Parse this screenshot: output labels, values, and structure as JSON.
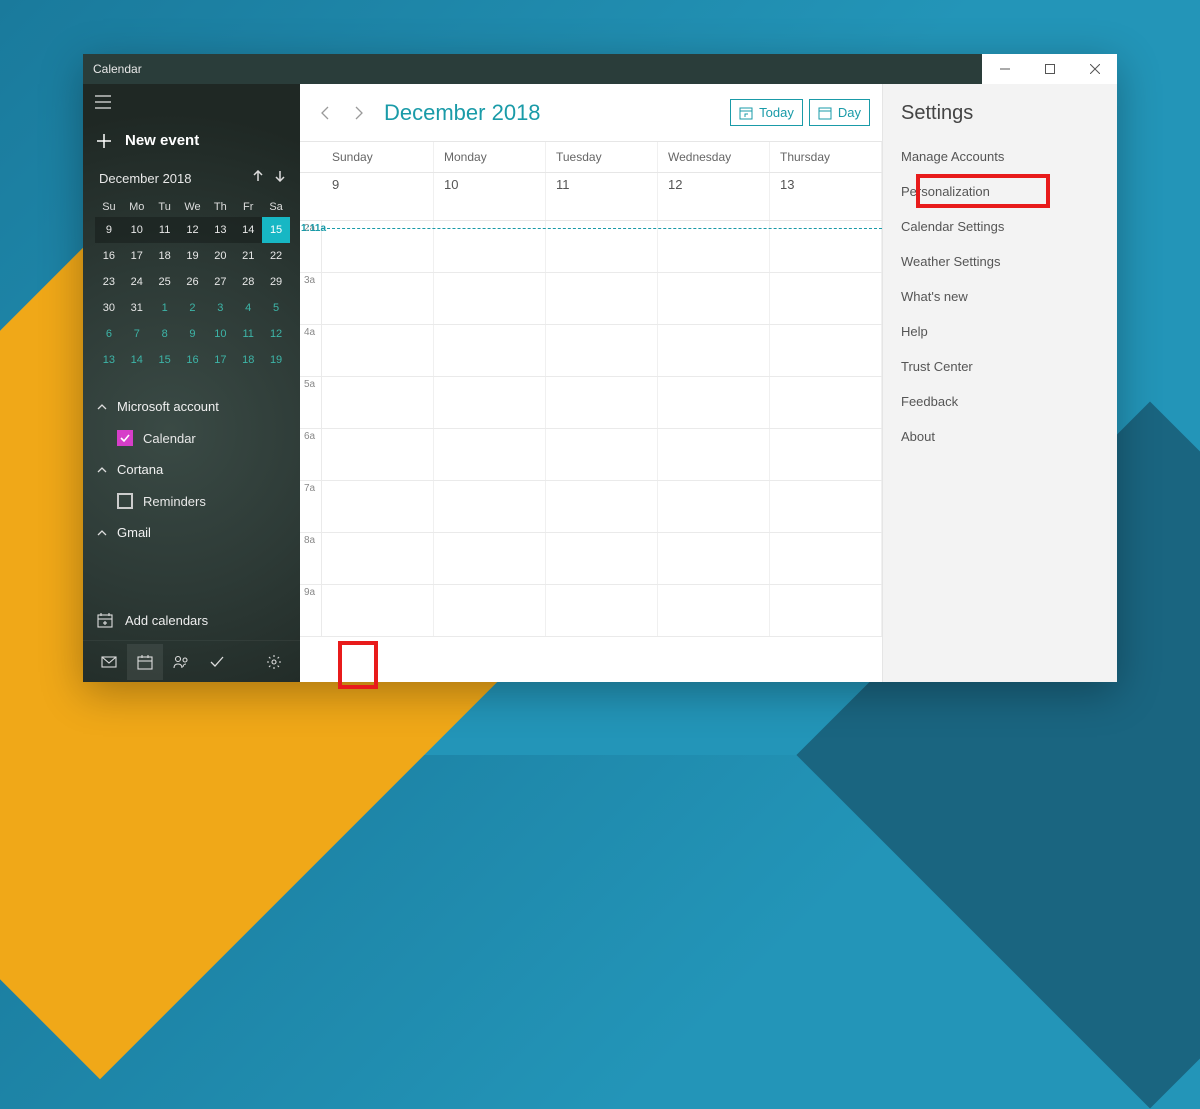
{
  "titlebar": {
    "title": "Calendar"
  },
  "sidebar": {
    "new_event": "New event",
    "mini_cal": {
      "label": "December 2018",
      "dow": [
        "Su",
        "Mo",
        "Tu",
        "We",
        "Th",
        "Fr",
        "Sa"
      ],
      "weeks": [
        [
          {
            "n": 9,
            "dim": true
          },
          {
            "n": 10,
            "dim": true
          },
          {
            "n": 11,
            "dim": true
          },
          {
            "n": 12,
            "dim": true
          },
          {
            "n": 13,
            "dim": true
          },
          {
            "n": 14,
            "dim": true
          },
          {
            "n": 15,
            "selected": true
          }
        ],
        [
          {
            "n": 16
          },
          {
            "n": 17
          },
          {
            "n": 18
          },
          {
            "n": 19
          },
          {
            "n": 20
          },
          {
            "n": 21
          },
          {
            "n": 22
          }
        ],
        [
          {
            "n": 23
          },
          {
            "n": 24
          },
          {
            "n": 25
          },
          {
            "n": 26
          },
          {
            "n": 27
          },
          {
            "n": 28
          },
          {
            "n": 29
          }
        ],
        [
          {
            "n": 30
          },
          {
            "n": 31
          },
          {
            "n": 1,
            "other": true
          },
          {
            "n": 2,
            "other": true
          },
          {
            "n": 3,
            "other": true
          },
          {
            "n": 4,
            "other": true
          },
          {
            "n": 5,
            "other": true
          }
        ],
        [
          {
            "n": 6,
            "other": true
          },
          {
            "n": 7,
            "other": true
          },
          {
            "n": 8,
            "other": true
          },
          {
            "n": 9,
            "other": true
          },
          {
            "n": 10,
            "other": true
          },
          {
            "n": 11,
            "other": true
          },
          {
            "n": 12,
            "other": true
          }
        ],
        [
          {
            "n": 13,
            "other": true
          },
          {
            "n": 14,
            "other": true
          },
          {
            "n": 15,
            "other": true
          },
          {
            "n": 16,
            "other": true
          },
          {
            "n": 17,
            "other": true
          },
          {
            "n": 18,
            "other": true
          },
          {
            "n": 19,
            "other": true
          }
        ]
      ]
    },
    "accounts": [
      {
        "name": "Microsoft account",
        "items": [
          {
            "label": "Calendar",
            "checked": true
          }
        ]
      },
      {
        "name": "Cortana",
        "items": [
          {
            "label": "Reminders",
            "checked": false
          }
        ]
      },
      {
        "name": "Gmail",
        "items": []
      }
    ],
    "add_calendars": "Add calendars",
    "footer_icons": [
      "mail",
      "calendar",
      "people",
      "todo",
      "settings"
    ]
  },
  "main": {
    "month_title": "December 2018",
    "today_label": "Today",
    "view_label": "Day",
    "day_names": [
      "Sunday",
      "Monday",
      "Tuesday",
      "Wednesday",
      "Thursday"
    ],
    "dates": [
      "9",
      "10",
      "11",
      "12",
      "13"
    ],
    "current_time": "1:11a",
    "time_labels": [
      "2a",
      "3a",
      "4a",
      "5a",
      "6a",
      "7a",
      "8a",
      "9a"
    ]
  },
  "settings": {
    "title": "Settings",
    "items": [
      "Manage Accounts",
      "Personalization",
      "Calendar Settings",
      "Weather Settings",
      "What's new",
      "Help",
      "Trust Center",
      "Feedback",
      "About"
    ]
  }
}
